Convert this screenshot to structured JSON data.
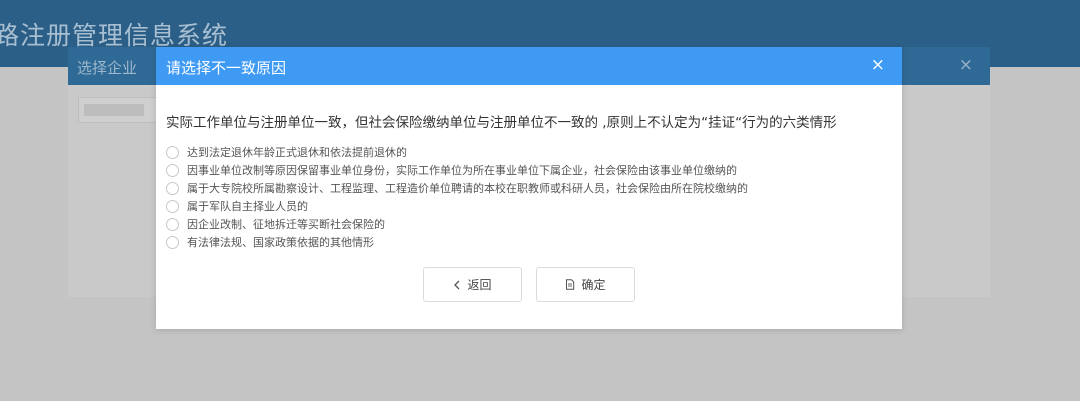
{
  "app": {
    "title": "路注册管理信息系统"
  },
  "background_dialog": {
    "title": "选择企业",
    "close_glyph": "×"
  },
  "modal": {
    "title": "请选择不一致原因",
    "close_glyph": "×",
    "intro": "实际工作单位与注册单位一致，但社会保险缴纳单位与注册单位不一致的 ,原则上不认定为“挂证“行为的六类情形",
    "options": [
      {
        "label": "达到法定退休年龄正式退休和依法提前退休的",
        "selected": false
      },
      {
        "label": "因事业单位改制等原因保留事业单位身份，实际工作单位为所在事业单位下属企业，社会保险由该事业单位缴纳的",
        "selected": false
      },
      {
        "label": "属于大专院校所属勘察设计、工程监理、工程造价单位聘请的本校在职教师或科研人员，社会保险由所在院校缴纳的",
        "selected": false
      },
      {
        "label": "属于军队自主择业人员的",
        "selected": false
      },
      {
        "label": "因企业改制、征地拆迁等买断社会保险的",
        "selected": false
      },
      {
        "label": "有法律法规、国家政策依据的其他情形",
        "selected": false
      }
    ],
    "buttons": {
      "back": {
        "label": "返回",
        "icon": "chevron-left-icon"
      },
      "confirm": {
        "label": "确定",
        "icon": "document-icon"
      }
    }
  },
  "colors": {
    "modal_header": "#3f9af4",
    "app_header_dimmed": "#2c5f87",
    "overlay": "#c4c4c4"
  }
}
